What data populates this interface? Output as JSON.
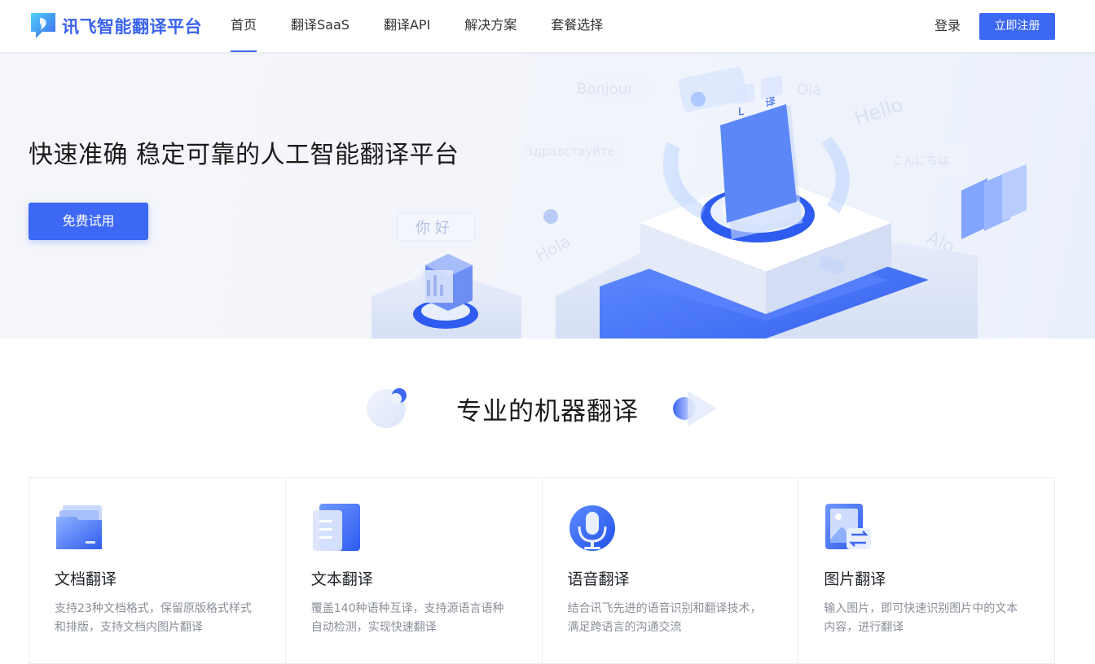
{
  "header": {
    "logo_text": "讯飞智能翻译平台",
    "nav": [
      {
        "label": "首页",
        "active": true
      },
      {
        "label": "翻译SaaS",
        "active": false
      },
      {
        "label": "翻译API",
        "active": false
      },
      {
        "label": "解决方案",
        "active": false
      },
      {
        "label": "套餐选择",
        "active": false
      }
    ],
    "login_label": "登录",
    "register_label": "立即注册"
  },
  "hero": {
    "title": "快速准确 稳定可靠的人工智能翻译平台",
    "cta_label": "免费试用",
    "bubbles": [
      "Bonjour",
      "Olá",
      "Hello",
      "Здравствуйте",
      "こんにちは",
      "你 好",
      "Hola",
      "Alo",
      "译",
      "L"
    ]
  },
  "section": {
    "title": "专业的机器翻译"
  },
  "cards": [
    {
      "icon": "folder-document-icon",
      "title": "文档翻译",
      "desc": "支持23种文档格式，保留原版格式样式和排版，支持文档内图片翻译"
    },
    {
      "icon": "text-document-icon",
      "title": "文本翻译",
      "desc": "覆盖140种语种互译，支持源语言语种自动检测，实现快速翻译"
    },
    {
      "icon": "microphone-icon",
      "title": "语音翻译",
      "desc": "结合讯飞先进的语音识别和翻译技术，满足跨语言的沟通交流"
    },
    {
      "icon": "image-translate-icon",
      "title": "图片翻译",
      "desc": "输入图片，即可快速识别图片中的文本内容，进行翻译"
    }
  ],
  "colors": {
    "brand": "#3d68f4",
    "text": "#1f2329",
    "muted": "#8a8f99",
    "border": "#ebedf2"
  }
}
